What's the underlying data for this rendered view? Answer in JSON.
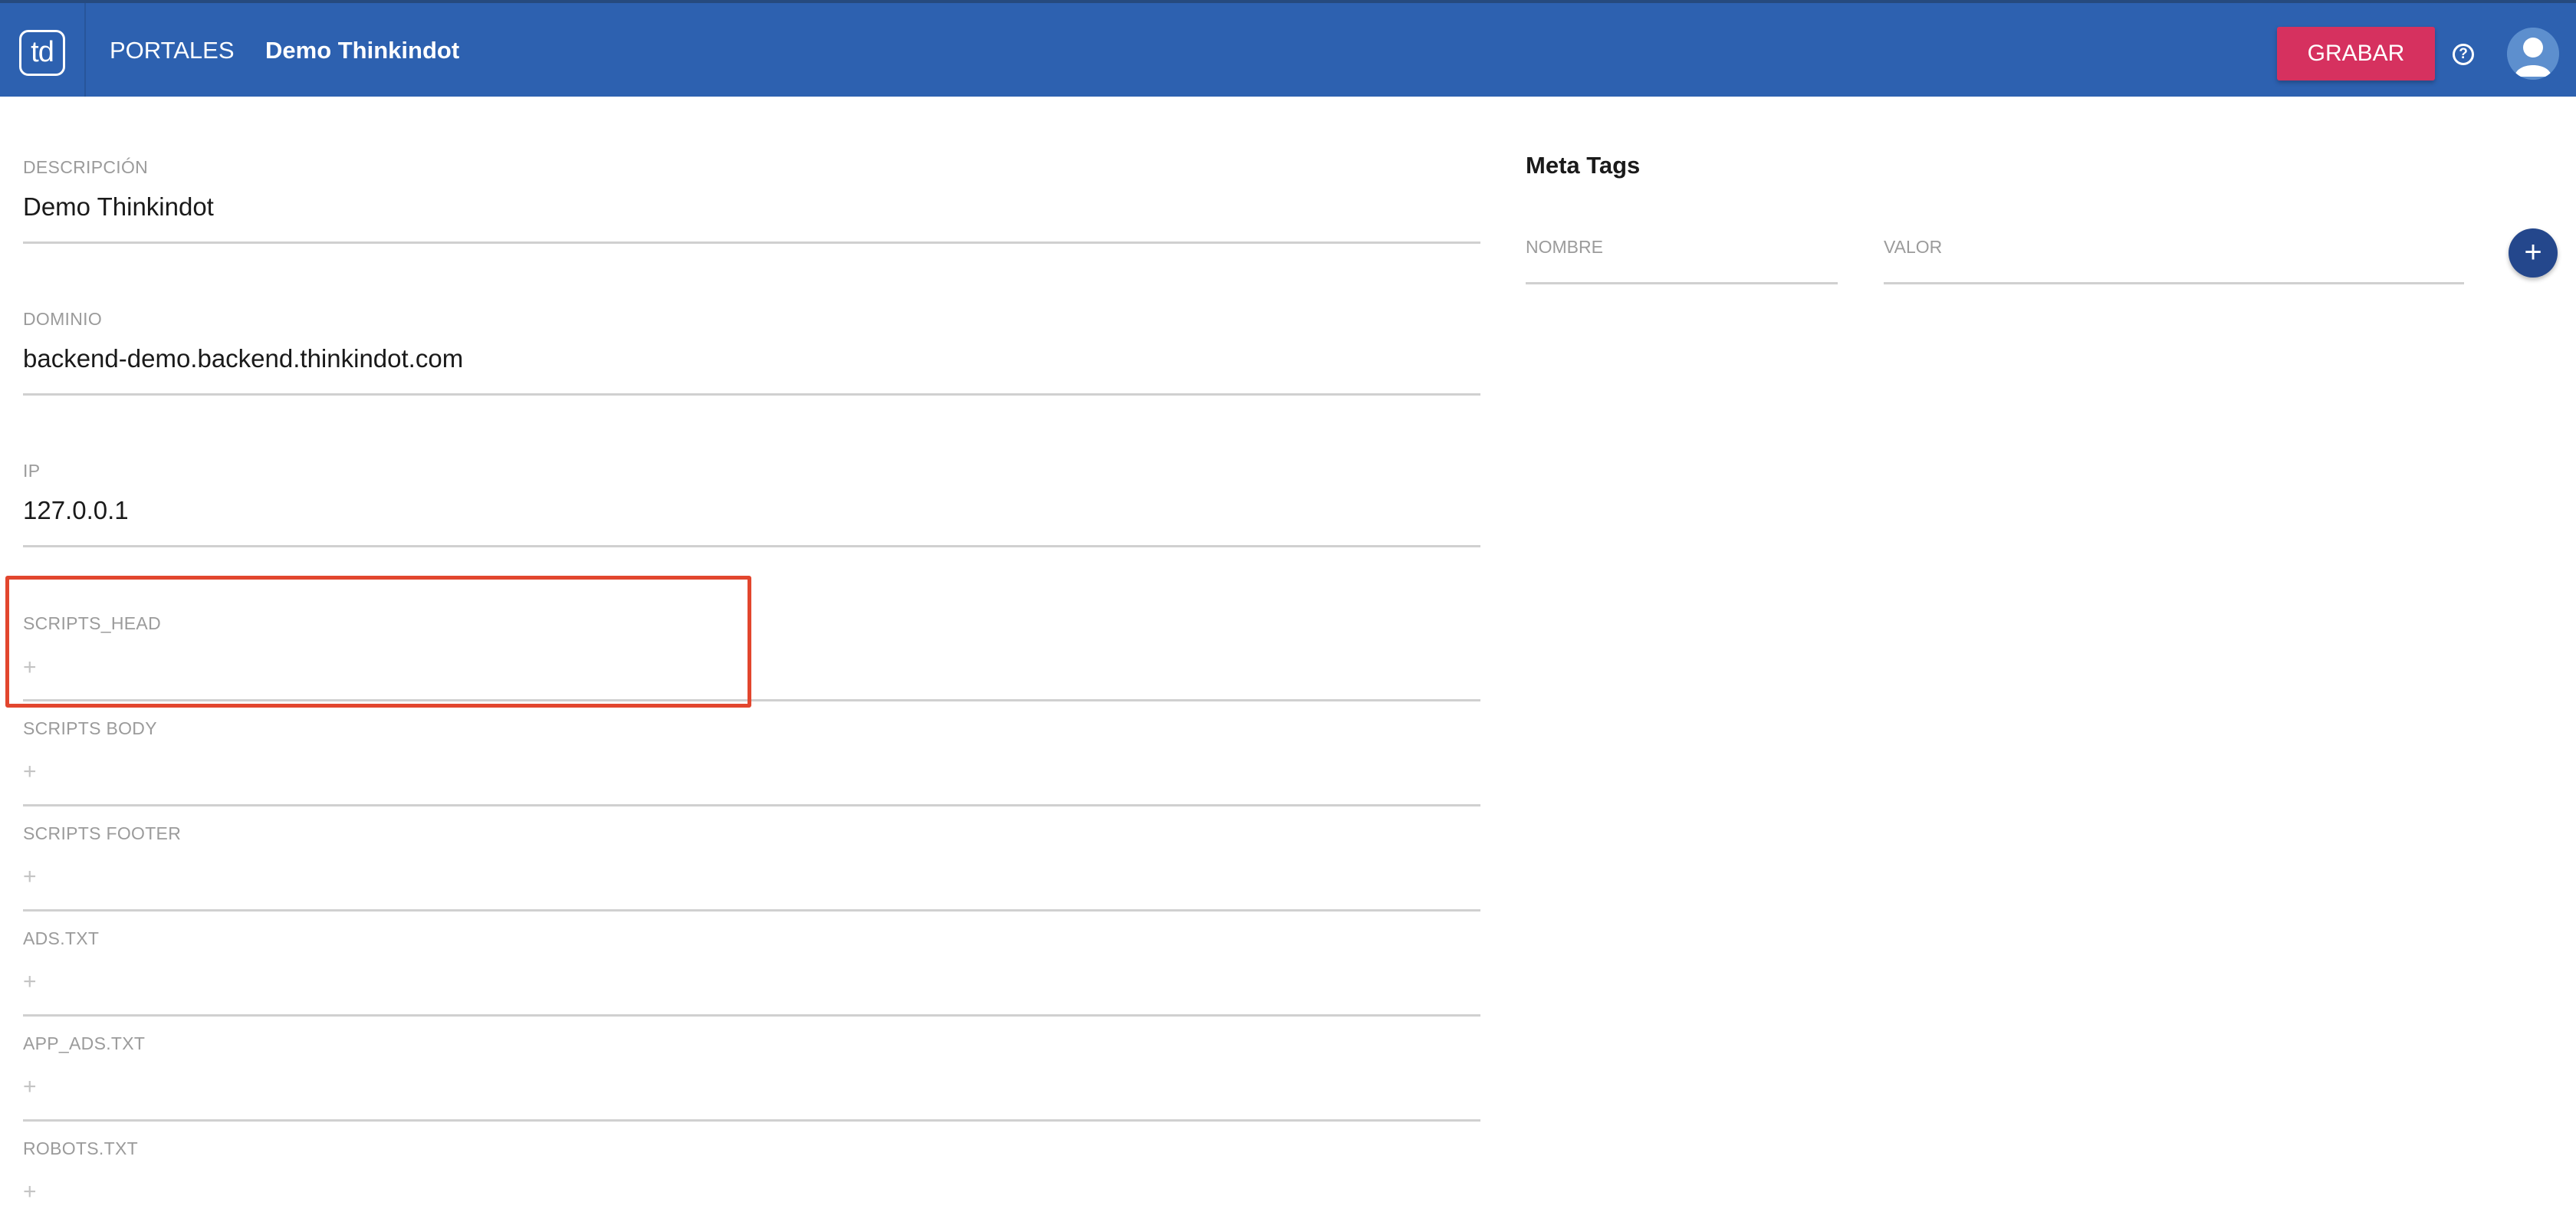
{
  "header": {
    "logo_text": "td",
    "nav_portales": "PORTALES",
    "page_title": "Demo Thinkindot",
    "save_label": "GRABAR",
    "help_icon": "help-circle-icon",
    "avatar_icon": "user-avatar-icon",
    "colors": {
      "bar": "#2d61b0",
      "save_button": "#d6315f"
    }
  },
  "form": {
    "descripcion": {
      "label": "DESCRIPCIÓN",
      "value": "Demo Thinkindot"
    },
    "dominio": {
      "label": "DOMINIO",
      "value": "backend-demo.backend.thinkindot.com"
    },
    "ip": {
      "label": "IP",
      "value": "127.0.0.1"
    },
    "scripts_head": {
      "label": "SCRIPTS_HEAD",
      "add": "+"
    },
    "scripts_body": {
      "label": "SCRIPTS BODY",
      "add": "+"
    },
    "scripts_footer": {
      "label": "SCRIPTS FOOTER",
      "add": "+"
    },
    "ads_txt": {
      "label": "ADS.TXT",
      "add": "+"
    },
    "app_ads_txt": {
      "label": "APP_ADS.TXT",
      "add": "+"
    },
    "robots_txt": {
      "label": "ROBOTS.TXT",
      "add": "+"
    }
  },
  "meta_tags": {
    "title": "Meta Tags",
    "nombre_label": "NOMBRE",
    "valor_label": "VALOR",
    "add_label": "+"
  },
  "annotation": {
    "highlight_color": "#e2462e"
  }
}
